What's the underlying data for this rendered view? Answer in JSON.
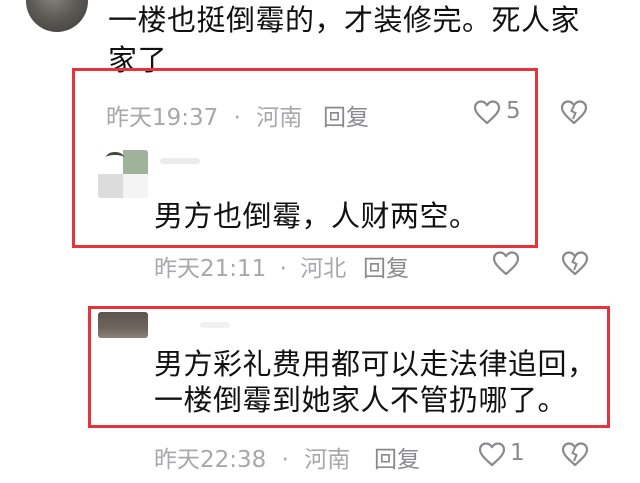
{
  "comment_1": {
    "text_line1": "一楼也挺倒霉的，才装修完。死人家",
    "text_line2": "家了",
    "time": "昨天19:37",
    "region": "河南",
    "reply_label": "回复",
    "like_count": "5"
  },
  "reply_1": {
    "text": "男方也倒霉，人财两空。",
    "time": "昨天21:11",
    "region": "河北",
    "reply_label": "回复"
  },
  "reply_2": {
    "text_line1": "男方彩礼费用都可以走法律追回，",
    "text_line2": "一楼倒霉到她家人不管扔哪了。",
    "time": "昨天22:38",
    "region": "河南",
    "reply_label": "回复",
    "like_count": "1"
  },
  "separator": "·",
  "colors": {
    "annotation_red": "#e8323c",
    "meta_gray": "#a8a8ab",
    "text": "#111111"
  },
  "icons": [
    "heart-outline-icon",
    "broken-heart-icon"
  ]
}
